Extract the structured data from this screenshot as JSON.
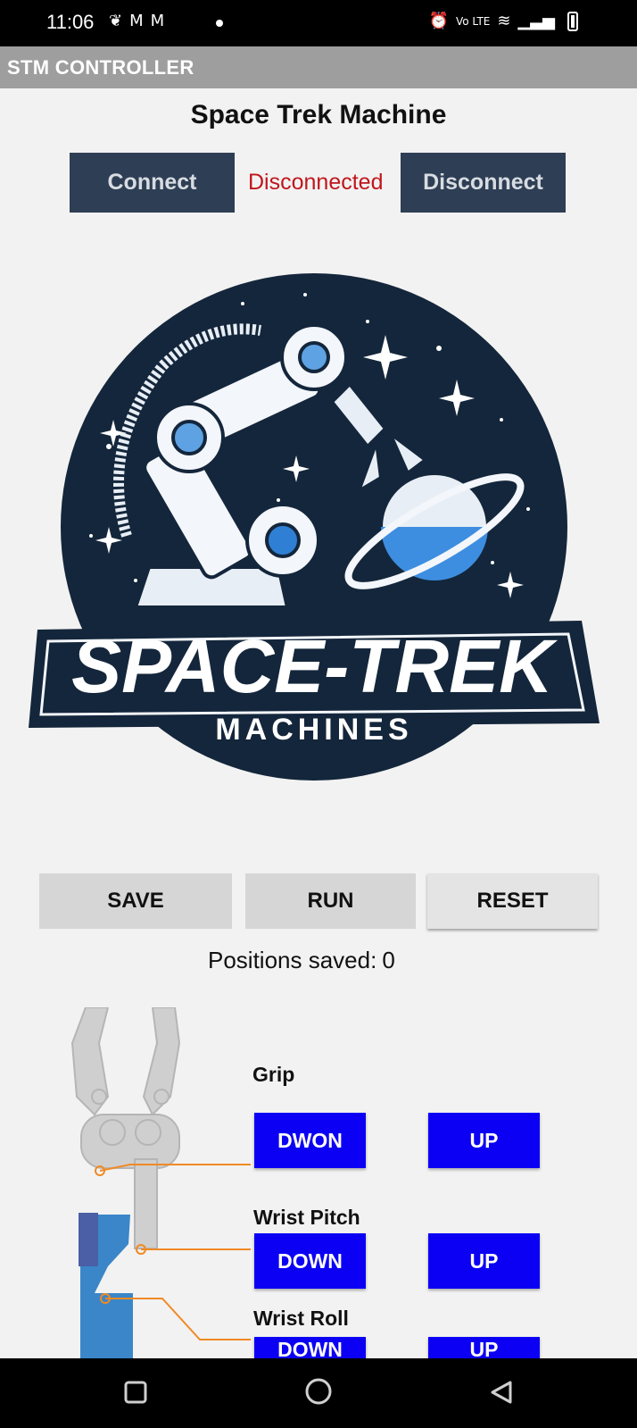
{
  "status_bar": {
    "time": "11:06",
    "icons_left": [
      "leaf-icon",
      "gmail-icon",
      "gmail-icon",
      "dot-icon"
    ],
    "icons_right": [
      "alarm-icon",
      "volte-icon",
      "wifi-icon",
      "signal-icon",
      "battery-icon"
    ]
  },
  "app_bar": {
    "title": "STM CONTROLLER"
  },
  "header": {
    "title": "Space Trek Machine"
  },
  "connection": {
    "connect_label": "Connect",
    "status_text": "Disconnected",
    "disconnect_label": "Disconnect",
    "status_color": "#c0161c"
  },
  "logo": {
    "text_main": "SPACE-TREK",
    "text_sub": "MACHINES"
  },
  "actions": {
    "save": "SAVE",
    "run": "RUN",
    "reset": "RESET"
  },
  "positions": {
    "label": "Positions saved:",
    "count": "0"
  },
  "controls": [
    {
      "name": "Grip",
      "down": "DWON",
      "up": "UP"
    },
    {
      "name": "Wrist Pitch",
      "down": "DOWN",
      "up": "UP"
    },
    {
      "name": "Wrist Roll",
      "down": "DOWN",
      "up": "UP"
    }
  ],
  "colors": {
    "dark_button": "#2e3e54",
    "blue_button": "#0b00f4",
    "app_bar": "#9e9e9e"
  },
  "nav_bar": {
    "icons": [
      "recents-square-icon",
      "home-circle-icon",
      "back-triangle-icon"
    ]
  }
}
